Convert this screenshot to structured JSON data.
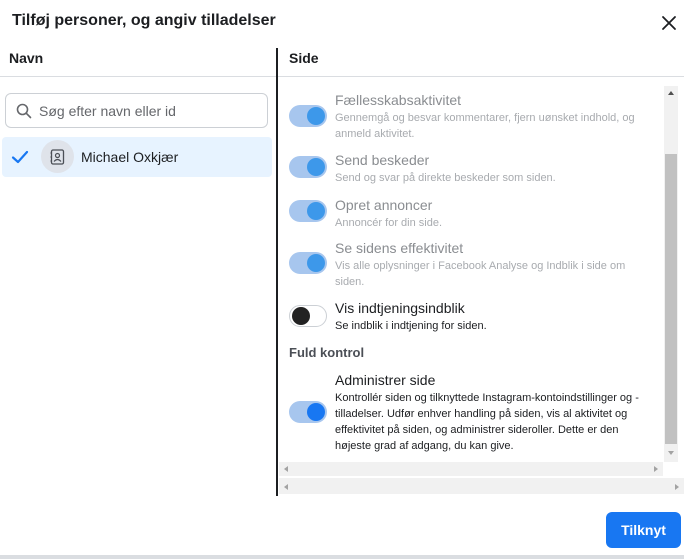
{
  "dialog": {
    "title": "Tilføj personer, og angiv tilladelser",
    "close_icon": "close-icon"
  },
  "columns": {
    "left_header": "Navn",
    "right_header": "Side"
  },
  "search": {
    "placeholder": "Søg efter navn eller id",
    "value": "",
    "icon": "search-icon"
  },
  "people": [
    {
      "name": "Michael Oxkjær",
      "selected": true,
      "avatar_icon": "person-badge-icon"
    }
  ],
  "permissions": [
    {
      "title": "Fællesskabsaktivitet",
      "description": "Gennemgå og besvar kommentarer, fjern uønsket indhold, og anmeld aktivitet.",
      "state": "on",
      "disabled": true
    },
    {
      "title": "Send beskeder",
      "description": "Send og svar på direkte beskeder som siden.",
      "state": "on",
      "disabled": true
    },
    {
      "title": "Opret annoncer",
      "description": "Annoncér for din side.",
      "state": "on",
      "disabled": true
    },
    {
      "title": "Se sidens effektivitet",
      "description": "Vis alle oplysninger i Facebook Analyse og Indblik i side om siden.",
      "state": "on",
      "disabled": true
    },
    {
      "title": "Vis indtjeningsindblik",
      "description": "Se indblik i indtjening for siden.",
      "state": "off",
      "disabled": false
    }
  ],
  "full_control": {
    "section_label": "Fuld kontrol",
    "title": "Administrer side",
    "description": "Kontrollér siden og tilknyttede Instagram-kontoindstillinger og -tilladelser. Udfør enhver handling på siden, vis al aktivitet og effektivitet på siden, og administrer sideroller. Dette er den højeste grad af adgang, du kan give.",
    "state": "on",
    "disabled": false
  },
  "footer": {
    "connect_label": "Tilknyt"
  },
  "colors": {
    "accent": "#1877f2",
    "selected_row": "#e7f3ff",
    "toggle_track": "#a7c6ee"
  }
}
